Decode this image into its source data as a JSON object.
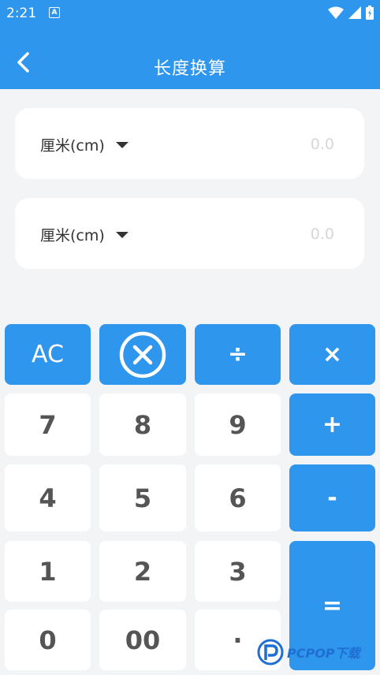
{
  "status_bar": {
    "time": "2:21",
    "notification_icon": "A"
  },
  "header": {
    "title": "长度换算"
  },
  "converter": {
    "from": {
      "unit": "厘米(cm)",
      "value": "0.0"
    },
    "to": {
      "unit": "厘米(cm)",
      "value": "0.0"
    }
  },
  "keypad": {
    "ac": "AC",
    "divide": "÷",
    "multiply": "×",
    "plus": "+",
    "minus": "-",
    "equals": "=",
    "k7": "7",
    "k8": "8",
    "k9": "9",
    "k4": "4",
    "k5": "5",
    "k6": "6",
    "k1": "1",
    "k2": "2",
    "k3": "3",
    "k0": "0",
    "k00": "00",
    "dot": "·"
  },
  "watermark": {
    "text": "PCPOP下载"
  },
  "colors": {
    "primary": "#2f96ee",
    "background": "#f3f4f6",
    "placeholder": "#d7d7d7"
  }
}
